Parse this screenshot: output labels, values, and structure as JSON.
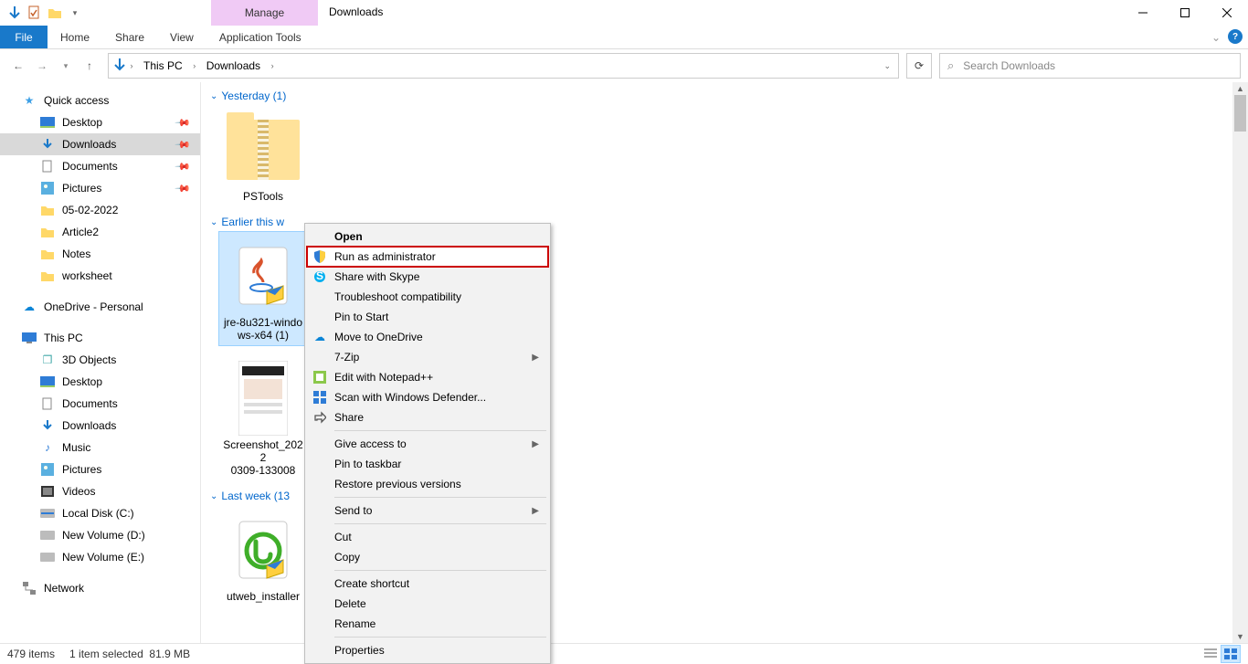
{
  "title": "Downloads",
  "ribbon_context_label": "Manage",
  "ribbon": {
    "file": "File",
    "tabs": [
      "Home",
      "Share",
      "View",
      "Application Tools"
    ]
  },
  "breadcrumb": {
    "segments": [
      "This PC",
      "Downloads"
    ]
  },
  "search": {
    "placeholder": "Search Downloads"
  },
  "sidebar": {
    "quick_access": {
      "label": "Quick access"
    },
    "pinned": [
      {
        "label": "Desktop"
      },
      {
        "label": "Downloads",
        "selected": true
      },
      {
        "label": "Documents"
      },
      {
        "label": "Pictures"
      }
    ],
    "folders": [
      {
        "label": "05-02-2022"
      },
      {
        "label": "Article2"
      },
      {
        "label": "Notes"
      },
      {
        "label": "worksheet"
      }
    ],
    "onedrive": {
      "label": "OneDrive - Personal"
    },
    "thispc": {
      "label": "This PC"
    },
    "thispc_items": [
      {
        "label": "3D Objects"
      },
      {
        "label": "Desktop"
      },
      {
        "label": "Documents"
      },
      {
        "label": "Downloads"
      },
      {
        "label": "Music"
      },
      {
        "label": "Pictures"
      },
      {
        "label": "Videos"
      },
      {
        "label": "Local Disk (C:)"
      },
      {
        "label": "New Volume (D:)"
      },
      {
        "label": "New Volume (E:)"
      }
    ],
    "network": {
      "label": "Network"
    }
  },
  "groups": {
    "yesterday": {
      "label": "Yesterday (1)",
      "items": [
        {
          "name": "PSTools"
        }
      ]
    },
    "earlier_week": {
      "label": "Earlier this w",
      "items": [
        {
          "name": "jre-8u321-windows-x64 (1)",
          "label_line1": "jre-8u321-windo",
          "label_line2": "ws-x64 (1)",
          "selected": true
        },
        {
          "name": "Screenshot_20220309-133008",
          "label_line1": "Screenshot_2022",
          "label_line2": "0309-133008"
        }
      ]
    },
    "last_week": {
      "label": "Last week (13",
      "items": [
        {
          "name": "utweb_installer",
          "label_line1": "utweb_installer"
        }
      ]
    }
  },
  "context_menu": {
    "items": [
      {
        "label": "Open",
        "bold": true
      },
      {
        "label": "Run as administrator",
        "icon": "shield",
        "highlight": true
      },
      {
        "label": "Share with Skype",
        "icon": "skype"
      },
      {
        "label": "Troubleshoot compatibility"
      },
      {
        "label": "Pin to Start"
      },
      {
        "label": "Move to OneDrive",
        "icon": "cloud"
      },
      {
        "label": "7-Zip",
        "submenu": true
      },
      {
        "label": "Edit with Notepad++",
        "icon": "npp"
      },
      {
        "label": "Scan with Windows Defender...",
        "icon": "defender"
      },
      {
        "label": "Share",
        "icon": "share"
      },
      {
        "sep": true
      },
      {
        "label": "Give access to",
        "submenu": true
      },
      {
        "label": "Pin to taskbar"
      },
      {
        "label": "Restore previous versions"
      },
      {
        "sep": true
      },
      {
        "label": "Send to",
        "submenu": true
      },
      {
        "sep": true
      },
      {
        "label": "Cut"
      },
      {
        "label": "Copy"
      },
      {
        "sep": true
      },
      {
        "label": "Create shortcut"
      },
      {
        "label": "Delete"
      },
      {
        "label": "Rename"
      },
      {
        "sep": true
      },
      {
        "label": "Properties"
      }
    ]
  },
  "status": {
    "count": "479 items",
    "selection": "1 item selected",
    "size": "81.9 MB"
  }
}
